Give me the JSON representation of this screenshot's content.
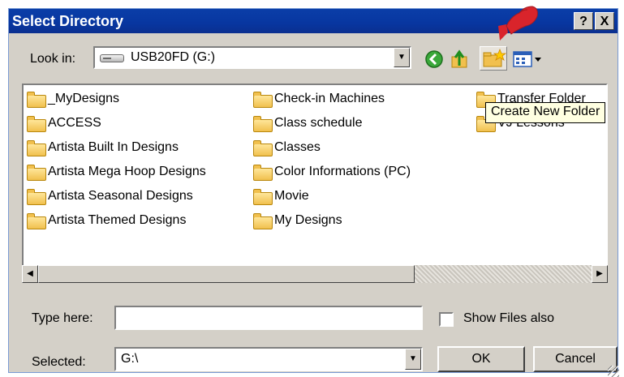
{
  "window": {
    "title": "Select Directory",
    "help_button": "?",
    "close_button": "X"
  },
  "lookin": {
    "label": "Look in:",
    "value": "USB20FD (G:)"
  },
  "toolbar": {
    "icons": [
      "back-icon",
      "up-folder-icon",
      "new-folder-icon",
      "view-menu-icon"
    ]
  },
  "tooltip": "Create New Folder",
  "folders": {
    "col1": [
      "_MyDesigns",
      "ACCESS",
      "Artista Built In Designs",
      "Artista Mega Hoop Designs",
      "Artista Seasonal Designs",
      "Artista Themed Designs"
    ],
    "col2": [
      "Check-in Machines",
      "Class schedule",
      "Classes",
      "Color Informations (PC)",
      "Movie",
      "My Designs"
    ],
    "col3": [
      "Transfer Folder",
      "VJ Lessons"
    ]
  },
  "type_here": {
    "label": "Type here:",
    "value": ""
  },
  "show_files": {
    "label": "Show Files also",
    "checked": false
  },
  "selected": {
    "label": "Selected:",
    "value": "G:\\"
  },
  "buttons": {
    "ok": "OK",
    "cancel": "Cancel"
  },
  "colors": {
    "titlebar": "#0a3ea8",
    "dialog_bg": "#d4d0c8",
    "folder": "#f1c04e",
    "tooltip_bg": "#ffffe1",
    "cursor": "#d9242b"
  }
}
